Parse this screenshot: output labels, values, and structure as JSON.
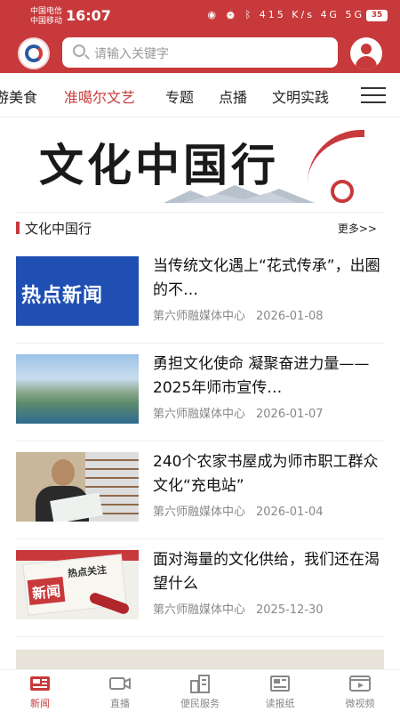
{
  "status_bar": {
    "carrier_1": "中国电信",
    "carrier_2": "中国移动",
    "time": "16:07",
    "battery": "35",
    "network_speed": "415 K/s",
    "signal_a": "4G",
    "signal_b": "5G"
  },
  "header": {
    "search_placeholder": "请输入关键字"
  },
  "tabs": [
    {
      "label": "游美食"
    },
    {
      "label": "准噶尔文艺",
      "active": true
    },
    {
      "label": "专题"
    },
    {
      "label": "点播"
    },
    {
      "label": "文明实践"
    }
  ],
  "banner": {
    "title": "文化中国行"
  },
  "section": {
    "title": "文化中国行",
    "more": "更多>>"
  },
  "news": [
    {
      "title": "当传统文化遇上“花式传承”，出圈的不…",
      "source": "第六师融媒体中心",
      "date": "2026-01-08",
      "thumb_text": "热点新闻"
    },
    {
      "title": "勇担文化使命 凝聚奋进力量——2025年师市宣传…",
      "source": "第六师融媒体中心",
      "date": "2026-01-07"
    },
    {
      "title": "240个农家书屋成为师市职工群众文化“充电站”",
      "source": "第六师融媒体中心",
      "date": "2026-01-04"
    },
    {
      "title": "面对海量的文化供给，我们还在渴望什么",
      "source": "第六师融媒体中心",
      "date": "2025-12-30",
      "thumb_text_1": "新闻",
      "thumb_text_2": "热点关注"
    }
  ],
  "bottom_nav": [
    {
      "label": "新闻",
      "icon": "newspaper-icon",
      "active": true
    },
    {
      "label": "直播",
      "icon": "video-camera-icon"
    },
    {
      "label": "便民服务",
      "icon": "buildings-icon"
    },
    {
      "label": "读报纸",
      "icon": "newspaper-read-icon"
    },
    {
      "label": "微视频",
      "icon": "film-icon"
    }
  ],
  "colors": {
    "brand_red": "#c8393b",
    "text_gray": "#888888"
  }
}
